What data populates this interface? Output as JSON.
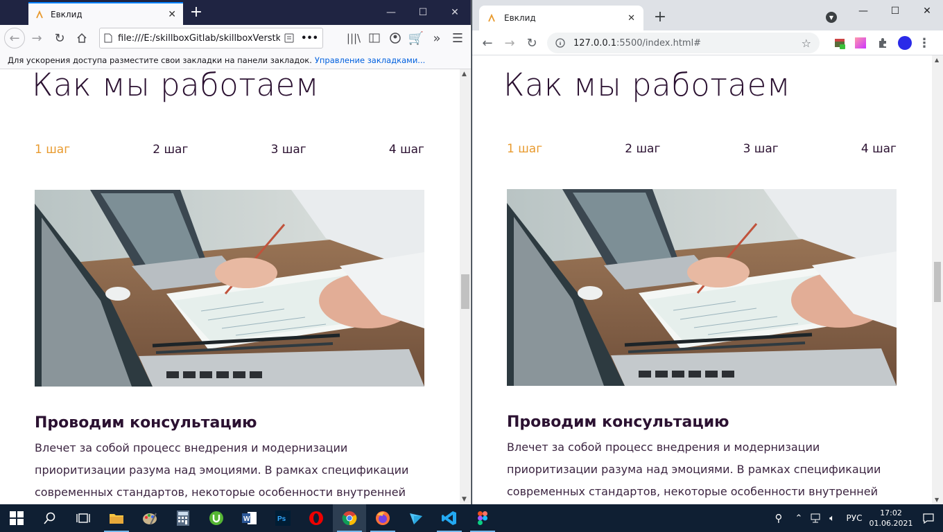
{
  "firefox": {
    "tab_title": "Евклид",
    "url": "file:///E:/skillboxGitlab/skillboxVerstkaKu",
    "bookmarks_hint": "Для ускорения доступа разместите свои закладки на панели закладок.",
    "bookmarks_link": "Управление закладками..."
  },
  "chrome": {
    "tab_title": "Евклид",
    "url_host": "127.0.0.1",
    "url_path": ":5500/index.html#",
    "extension_badge": "1"
  },
  "page": {
    "heading": "Как мы работаем",
    "steps": [
      "1 шаг",
      "2 шаг",
      "3 шаг",
      "4 шаг"
    ],
    "active_step": 0,
    "section_title": "Проводим консультацию",
    "paragraph_lines": [
      "Влечет за собой процесс внедрения и модернизации",
      "приоритизации разума над эмоциями. В рамках спецификации",
      "современных стандартов, некоторые особенности внутренней"
    ],
    "colors": {
      "text": "#2b1131",
      "accent": "#e89a2e"
    }
  },
  "taskbar": {
    "apps": [
      "start",
      "search",
      "task-view",
      "file-explorer",
      "paint",
      "calculator",
      "utorrent",
      "word",
      "photoshop",
      "opera",
      "chrome",
      "firefox",
      "yandex",
      "vscode",
      "figma"
    ],
    "language": "РУС",
    "time": "17:02",
    "date": "01.06.2021"
  }
}
